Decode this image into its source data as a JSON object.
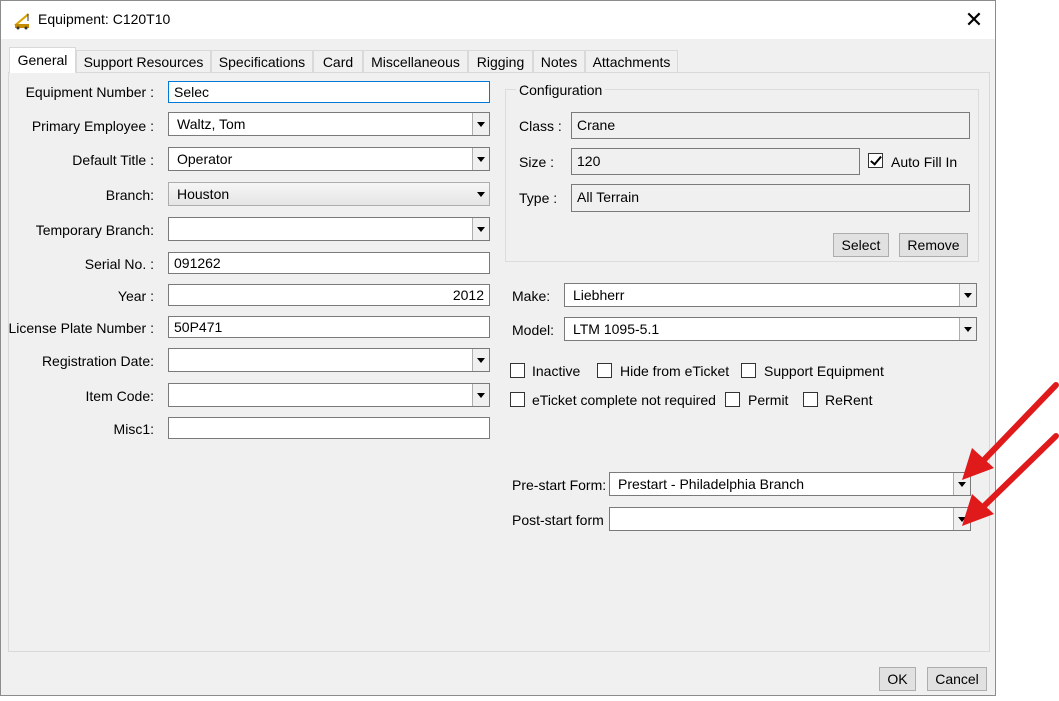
{
  "window": {
    "title": "Equipment: C120T10",
    "close_glyph": "✕"
  },
  "tabs": [
    "General",
    "Support Resources",
    "Specifications",
    "Card",
    "Miscellaneous",
    "Rigging",
    "Notes",
    "Attachments"
  ],
  "form": {
    "equipment_number_label": "Equipment Number :",
    "equipment_number_value": "Selec",
    "primary_employee_label": "Primary Employee :",
    "primary_employee_value": "Waltz, Tom",
    "default_title_label": "Default Title :",
    "default_title_value": "Operator",
    "branch_label": "Branch:",
    "branch_value": "Houston",
    "temporary_branch_label": "Temporary Branch:",
    "temporary_branch_value": "",
    "serial_no_label": "Serial No. :",
    "serial_no_value": "091262",
    "year_label": "Year :",
    "year_value": "2012",
    "license_plate_label": "License Plate Number :",
    "license_plate_value": "50P471",
    "registration_date_label": "Registration Date:",
    "registration_date_value": "",
    "item_code_label": "Item Code:",
    "item_code_value": "",
    "misc1_label": "Misc1:",
    "misc1_value": ""
  },
  "configuration": {
    "title": "Configuration",
    "class_label": "Class :",
    "class_value": "Crane",
    "size_label": "Size :",
    "size_value": "120",
    "auto_fill_label": "Auto Fill In",
    "type_label": "Type :",
    "type_value": "All Terrain",
    "select_label": "Select",
    "remove_label": "Remove"
  },
  "make_label": "Make:",
  "make_value": "Liebherr",
  "model_label": "Model:",
  "model_value": "LTM 1095-5.1",
  "checkboxes": {
    "inactive": "Inactive",
    "hide_eticket": "Hide from eTicket",
    "support_equipment": "Support Equipment",
    "eticket_not_required": "eTicket complete not required",
    "permit": "Permit",
    "rerent": "ReRent"
  },
  "prestart_label": "Pre-start Form:",
  "prestart_value": "Prestart - Philadelphia Branch",
  "poststart_label": "Post-start form",
  "poststart_value": "",
  "ok_label": "OK",
  "cancel_label": "Cancel",
  "colors": {
    "arrow": "#e0191b",
    "focus": "#0078d7"
  }
}
